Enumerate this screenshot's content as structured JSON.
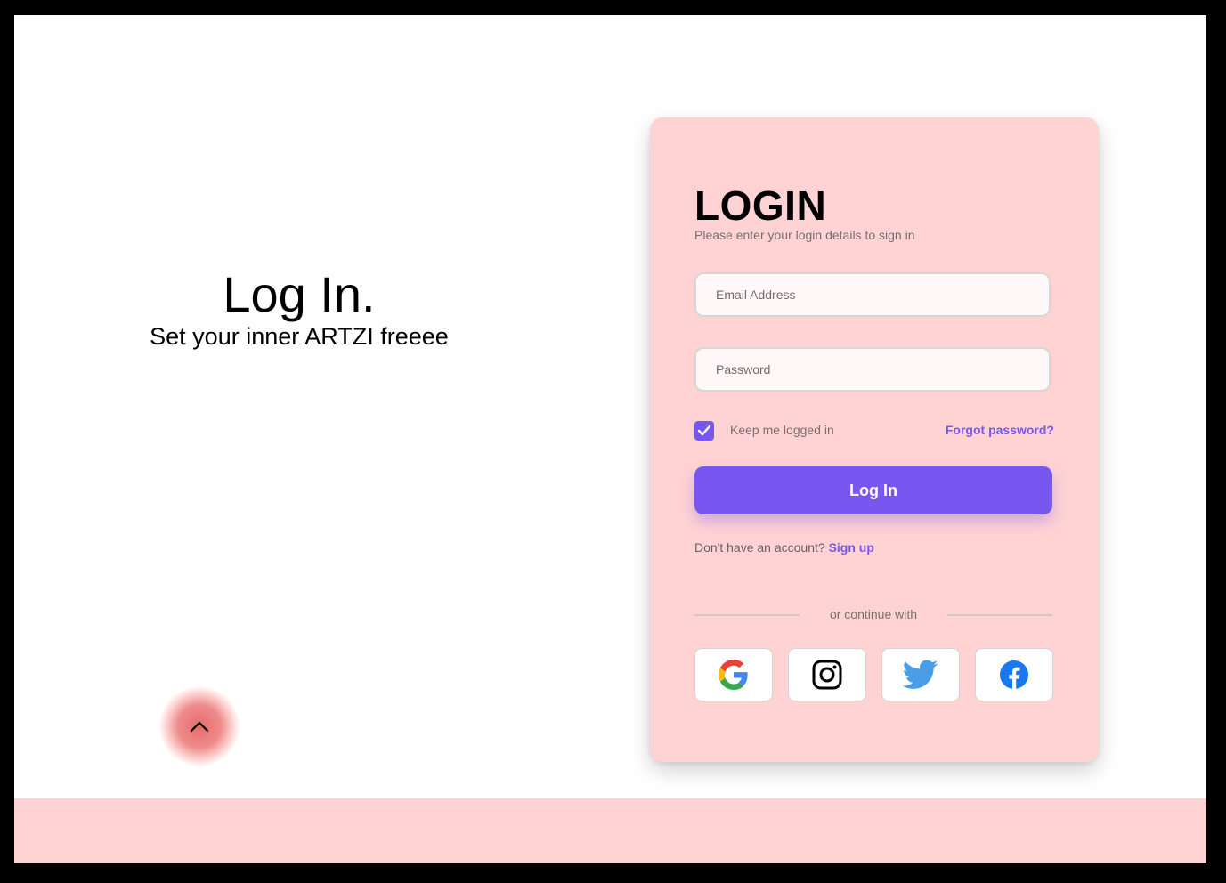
{
  "hero": {
    "title": "Log In.",
    "subtitle": "Set your inner ARTZI freeee"
  },
  "card": {
    "title": "LOGIN",
    "subtitle": "Please enter your login details to sign in"
  },
  "form": {
    "email_placeholder": "Email Address",
    "password_placeholder": "Password",
    "remember_label": "Keep me logged in",
    "remember_checked": true,
    "forgot_label": "Forgot password?",
    "submit_label": "Log In",
    "signup_prompt": "Don't have an account?",
    "signup_label": "Sign up",
    "divider_text": "or continue with"
  },
  "social": [
    {
      "name": "google-icon",
      "label": "Google"
    },
    {
      "name": "instagram-icon",
      "label": "Instagram"
    },
    {
      "name": "twitter-icon",
      "label": "Twitter"
    },
    {
      "name": "facebook-icon",
      "label": "Facebook"
    }
  ],
  "colors": {
    "accent": "#7757f0",
    "card_background": "#ffd3d3",
    "footer_background": "#ffd3d3",
    "scroll_button": "#e76a6a"
  },
  "icons": {
    "scroll_top": "chevron-up-icon",
    "checkbox": "check-icon"
  }
}
